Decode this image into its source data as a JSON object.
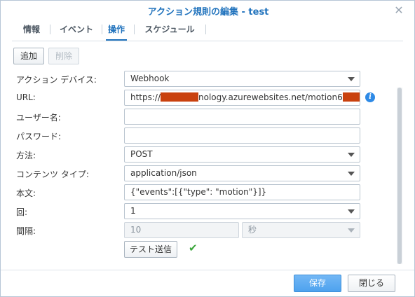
{
  "dialog": {
    "title": "アクション規則の編集 - test",
    "close_glyph": "✕"
  },
  "tabs": [
    {
      "label": "情報",
      "active": false
    },
    {
      "label": "イベント",
      "active": false
    },
    {
      "label": "操作",
      "active": true
    },
    {
      "label": "スケジュール",
      "active": false
    }
  ],
  "toolbar": {
    "add_label": "追加",
    "delete_label": "削除"
  },
  "form": {
    "action_device": {
      "label": "アクション デバイス:",
      "value": "Webhook"
    },
    "url": {
      "label": "URL:",
      "value_prefix": "https://",
      "value_middle": "nology.azurewebsites.net/motion6",
      "info_glyph": "i"
    },
    "username": {
      "label": "ユーザー名:",
      "value": ""
    },
    "password": {
      "label": "パスワード:",
      "value": ""
    },
    "method": {
      "label": "方法:",
      "value": "POST"
    },
    "content_type": {
      "label": "コンテンツ タイプ:",
      "value": "application/json"
    },
    "body": {
      "label": "本文:",
      "value": "{\"events\":[{\"type\": \"motion\"}]}"
    },
    "times": {
      "label": "回:",
      "value": "1"
    },
    "interval": {
      "label": "間隔:",
      "value": "10",
      "unit": "秒"
    },
    "test_send_label": "テスト送信",
    "test_result_glyph": "✔"
  },
  "footer": {
    "save_label": "保存",
    "close_label": "閉じる"
  },
  "colors": {
    "accent": "#2173bd",
    "redaction": "#c9410e",
    "success": "#3aa63a",
    "primary_button": "#4ea2ee"
  }
}
